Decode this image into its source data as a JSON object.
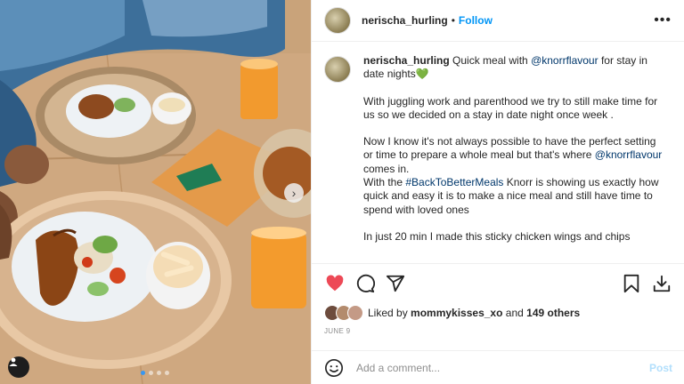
{
  "post": {
    "username": "nerischa_hurling",
    "separator": "•",
    "follow_label": "Follow",
    "more_label": "•••",
    "caption": {
      "username": "nerischa_hurling",
      "line1_text": " Quick meal with ",
      "mention1": "@knorrflavour",
      "line1_tail": " for stay in date nights",
      "heart_emoji": "💚",
      "para2": "With juggling work and parenthood we try to still make time for us so we decided on a stay in date night once week .",
      "para3_a": "Now I know it's not always possible to have the perfect setting or time to prepare a whole meal but that's where ",
      "mention2": "@knorrflavour",
      "para3_b": " comes in.",
      "para4_a": "With the ",
      "hashtag": "#BackToBetterMeals",
      "para4_b": " Knorr is showing us exactly how quick and easy it is to make a nice meal and still have time to spend with loved ones",
      "para5": "In just 20 min I made this sticky chicken wings and chips"
    },
    "likes": {
      "prefix": "Liked by ",
      "user": "mommykisses_xo",
      "middle": " and ",
      "count": "149 others"
    },
    "date": "JUNE 9",
    "comment": {
      "placeholder": "Add a comment...",
      "post_label": "Post"
    },
    "carousel": {
      "current_index": 1,
      "total": 4,
      "next_glyph": "›"
    },
    "colors": {
      "follow": "#0095f6",
      "like_heart": "#ed4956",
      "post_disabled": "#b2dffc"
    }
  }
}
